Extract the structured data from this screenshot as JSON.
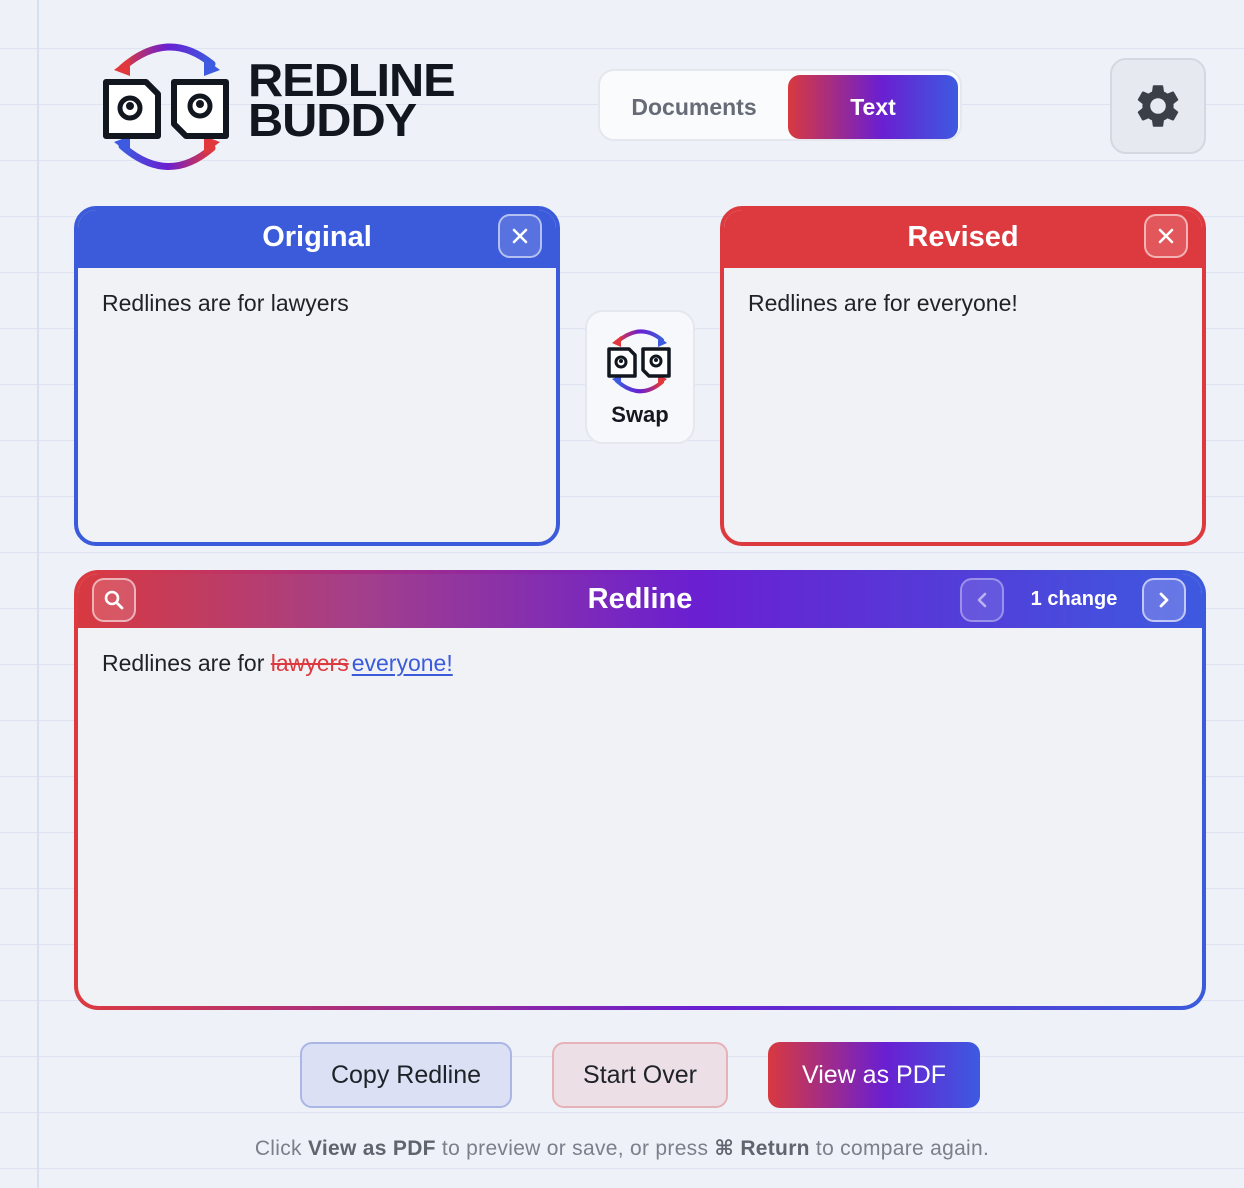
{
  "brand": {
    "line1": "REDLINE",
    "line2": "BUDDY"
  },
  "mode_toggle": {
    "documents_label": "Documents",
    "text_label": "Text",
    "selected": "Text"
  },
  "settings": {
    "icon": "gear-icon"
  },
  "original": {
    "title": "Original",
    "content": "Redlines are for lawyers",
    "close_icon": "close-icon"
  },
  "revised": {
    "title": "Revised",
    "content": "Redlines are for everyone!",
    "close_icon": "close-icon"
  },
  "swap": {
    "label": "Swap"
  },
  "redline": {
    "title": "Redline",
    "change_count": "1 change",
    "text_prefix": "Redlines are for ",
    "deleted": "lawyers",
    "inserted": "everyone!"
  },
  "actions": {
    "copy": "Copy Redline",
    "start_over": "Start Over",
    "view_pdf": "View as PDF"
  },
  "hint": {
    "part1": "Click ",
    "bold1": "View as PDF",
    "part2": " to preview or save, or press ",
    "bold2": "⌘ Return",
    "part3": " to compare again."
  },
  "colors": {
    "original": "#3b5bdb",
    "revised": "#dc3a3f",
    "accent_mid": "#6a1fd1"
  }
}
